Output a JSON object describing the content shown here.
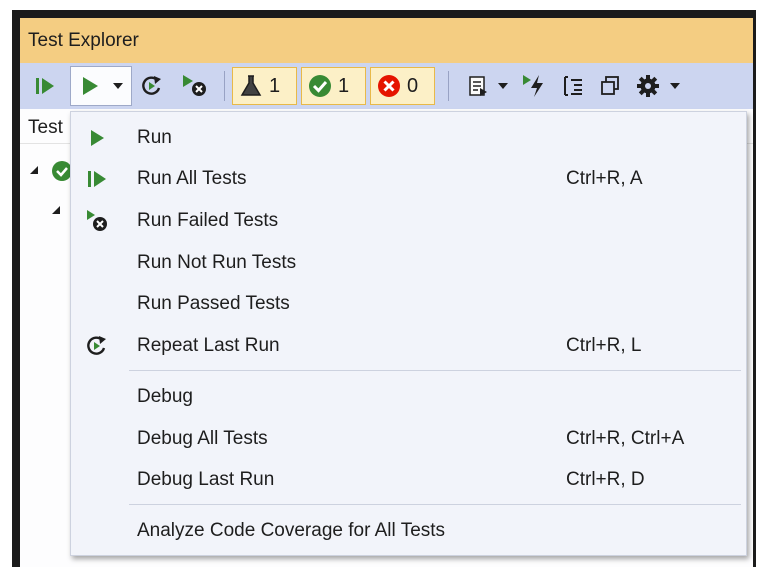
{
  "window": {
    "title": "Test Explorer"
  },
  "toolbar": {
    "filters": {
      "total_count": "1",
      "passed_count": "1",
      "failed_count": "0"
    },
    "icons": [
      "run-all-icon",
      "run-icon",
      "dropdown-arrow-icon",
      "repeat-icon",
      "run-failed-icon",
      "flask-icon",
      "check-icon",
      "error-icon",
      "playlist-icon",
      "lightning-run-icon",
      "group-icon",
      "copy-icon",
      "gear-icon"
    ]
  },
  "grid": {
    "column_header": "Test"
  },
  "menu": {
    "items": [
      {
        "label": "Run",
        "shortcut": "",
        "icon": "run-icon"
      },
      {
        "label": "Run All Tests",
        "shortcut": "Ctrl+R, A",
        "icon": "run-all-icon"
      },
      {
        "label": "Run Failed Tests",
        "shortcut": "",
        "icon": "run-failed-icon"
      },
      {
        "label": "Run Not Run Tests",
        "shortcut": "",
        "icon": ""
      },
      {
        "label": "Run Passed Tests",
        "shortcut": "",
        "icon": ""
      },
      {
        "label": "Repeat Last Run",
        "shortcut": "Ctrl+R, L",
        "icon": "repeat-icon"
      },
      {
        "label": "Debug",
        "shortcut": "",
        "icon": ""
      },
      {
        "label": "Debug All Tests",
        "shortcut": "Ctrl+R, Ctrl+A",
        "icon": ""
      },
      {
        "label": "Debug Last Run",
        "shortcut": "Ctrl+R, D",
        "icon": ""
      },
      {
        "label": "Analyze Code Coverage for All Tests",
        "shortcut": "",
        "icon": ""
      }
    ]
  },
  "colors": {
    "title_bar": "#f4cd82",
    "toolbar": "#ccd5f0",
    "menu": "#f2f4fa",
    "run_green": "#388a34",
    "fail_red": "#e51400",
    "filter_bg": "#fcf0c7"
  }
}
